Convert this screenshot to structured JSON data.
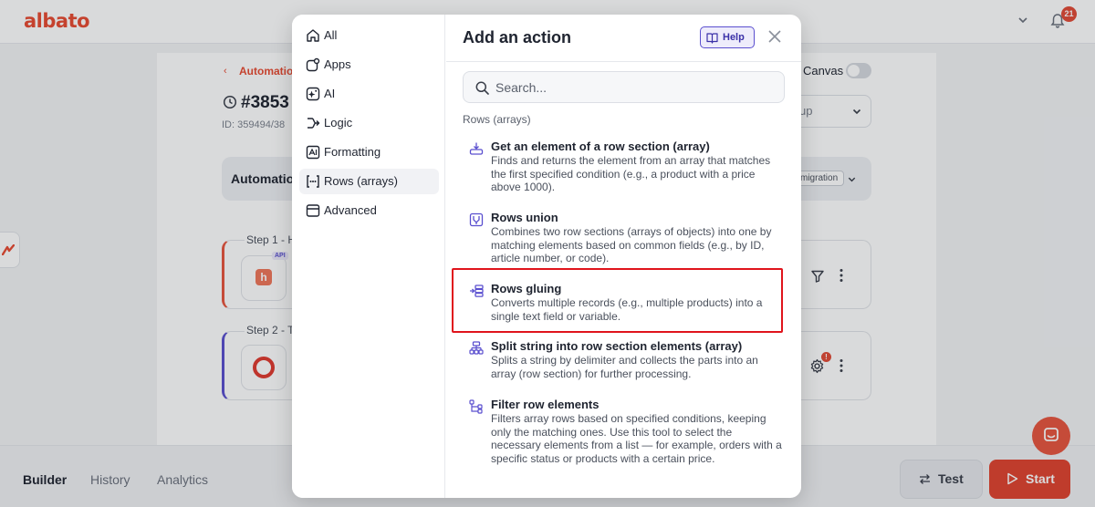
{
  "app": {
    "logo": "albato",
    "notifications_count": "21"
  },
  "background": {
    "breadcrumb": "Automation",
    "automation_number": "#3853",
    "automation_id": "ID: 359494/38",
    "canvas_label": "Canvas",
    "group_select": "up",
    "automation_bar_label": "Automatio",
    "migration_badge": "migration",
    "step1_label": "Step 1 - H",
    "step1_app_tag": "API",
    "step1_app_glyph": "h",
    "step2_label": "Step 2 - T",
    "gear_alert": "!"
  },
  "bottom": {
    "tabs": [
      "Builder",
      "History",
      "Analytics"
    ],
    "test_label": "Test",
    "start_label": "Start"
  },
  "modal": {
    "title": "Add an action",
    "help_label": "Help",
    "search_placeholder": "Search...",
    "categories": [
      {
        "label": "All",
        "icon": "home-icon"
      },
      {
        "label": "Apps",
        "icon": "apps-icon"
      },
      {
        "label": "AI",
        "icon": "ai-icon"
      },
      {
        "label": "Logic",
        "icon": "logic-icon"
      },
      {
        "label": "Formatting",
        "icon": "formatting-icon"
      },
      {
        "label": "Rows (arrays)",
        "icon": "array-icon",
        "active": true
      },
      {
        "label": "Advanced",
        "icon": "advanced-icon"
      }
    ],
    "section_label": "Rows (arrays)",
    "actions": [
      {
        "title": "Get an element of a row section (array)",
        "description": "Finds and returns the element from an array that matches the first specified condition (e.g., a product with a price above 1000)."
      },
      {
        "title": "Rows union",
        "description": "Combines two row sections (arrays of objects) into one by matching elements based on common fields (e.g., by ID, article number, or code)."
      },
      {
        "title": "Rows gluing",
        "description": "Converts multiple records (e.g., multiple products) into a single text field or variable."
      },
      {
        "title": "Split string into row section elements (array)",
        "description": "Splits a string by delimiter and collects the parts into an array (row section) for further processing."
      },
      {
        "title": "Filter row elements",
        "description": "Filters array rows based on specified conditions, keeping only the matching ones. Use this tool to select the necessary elements from a list — for example, orders with a specific status or products with a certain price."
      }
    ]
  },
  "colors": {
    "brand": "#e84a32",
    "accent": "#5a4fcf",
    "highlight": "#e0141c"
  }
}
